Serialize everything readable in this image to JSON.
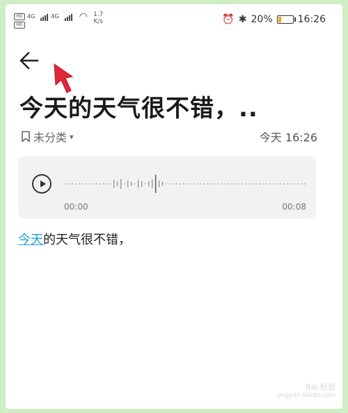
{
  "status_bar": {
    "hd1": "HD",
    "hd2": "HD",
    "net1": "4G",
    "net2": "4G",
    "speed_value": "1.7",
    "speed_unit": "K/s",
    "battery_percent": "20%",
    "battery_level": 0.2,
    "time": "16:26"
  },
  "note": {
    "title": "今天的天气很不错，..",
    "category": "未分类",
    "date": "今天 16:26",
    "body_highlight": "今天",
    "body_rest": "的天气很不错，"
  },
  "audio": {
    "start_time": "00:00",
    "end_time": "00:08",
    "progress": 0.37
  },
  "watermark": {
    "line1": "Bai 经验",
    "line2": "jingyan.baidu.com"
  },
  "icons": [
    "back-arrow-icon",
    "bookmark-icon",
    "chevron-down-icon",
    "play-icon",
    "wifi-icon",
    "alarm-icon",
    "bluetooth-icon",
    "battery-icon"
  ]
}
